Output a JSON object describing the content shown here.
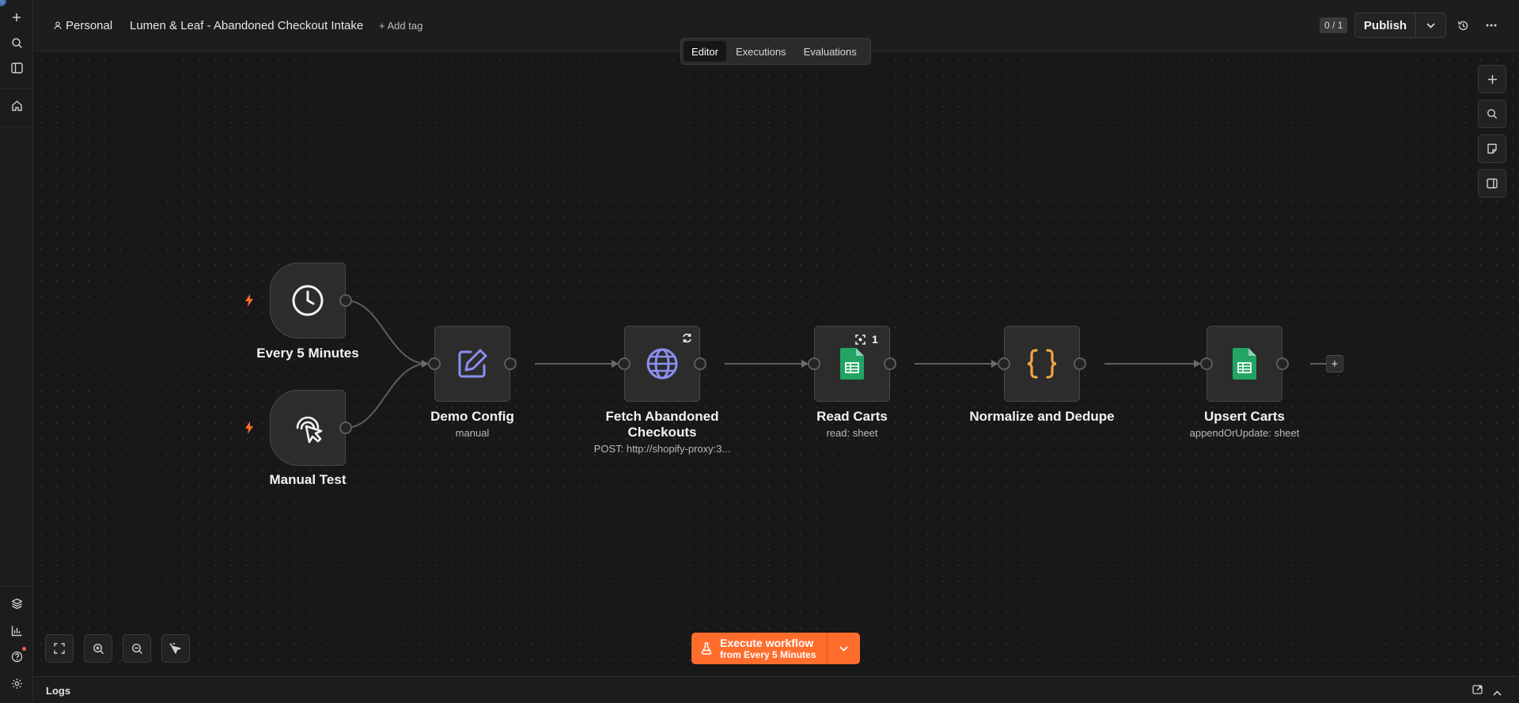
{
  "header": {
    "project": "Personal",
    "workflow_title": "Lumen & Leaf - Abandoned Checkout Intake",
    "add_tag": "+ Add tag",
    "counter": "0 / 1",
    "publish_label": "Publish"
  },
  "tabs": [
    {
      "label": "Editor",
      "active": true
    },
    {
      "label": "Executions",
      "active": false
    },
    {
      "label": "Evaluations",
      "active": false
    }
  ],
  "nodes": {
    "every5": {
      "label": "Every 5 Minutes",
      "icon": "clock-icon"
    },
    "manual": {
      "label": "Manual Test",
      "icon": "pointer-click-icon"
    },
    "demo": {
      "label": "Demo Config",
      "sub": "manual",
      "icon": "edit-icon"
    },
    "fetch": {
      "label_line1": "Fetch Abandoned",
      "label_line2": "Checkouts",
      "sub": "POST: http://shopify-proxy:3...",
      "icon": "globe-icon"
    },
    "read": {
      "label": "Read Carts",
      "sub": "read: sheet",
      "badge": "1",
      "icon": "google-sheets-icon"
    },
    "normalize": {
      "label": "Normalize and Dedupe",
      "icon": "braces-icon"
    },
    "upsert": {
      "label": "Upsert Carts",
      "sub": "appendOrUpdate: sheet",
      "icon": "google-sheets-icon"
    }
  },
  "execute": {
    "label": "Execute workflow",
    "from": "from Every 5 Minutes"
  },
  "logs": {
    "label": "Logs"
  },
  "colors": {
    "accent": "#ff6d2d",
    "canvas": "#181818",
    "node": "#2c2c2c",
    "edit_icon": "#8a8ff0",
    "globe_icon": "#8a8ff0",
    "braces_icon": "#f0a44a",
    "sheets": "#21a464"
  }
}
